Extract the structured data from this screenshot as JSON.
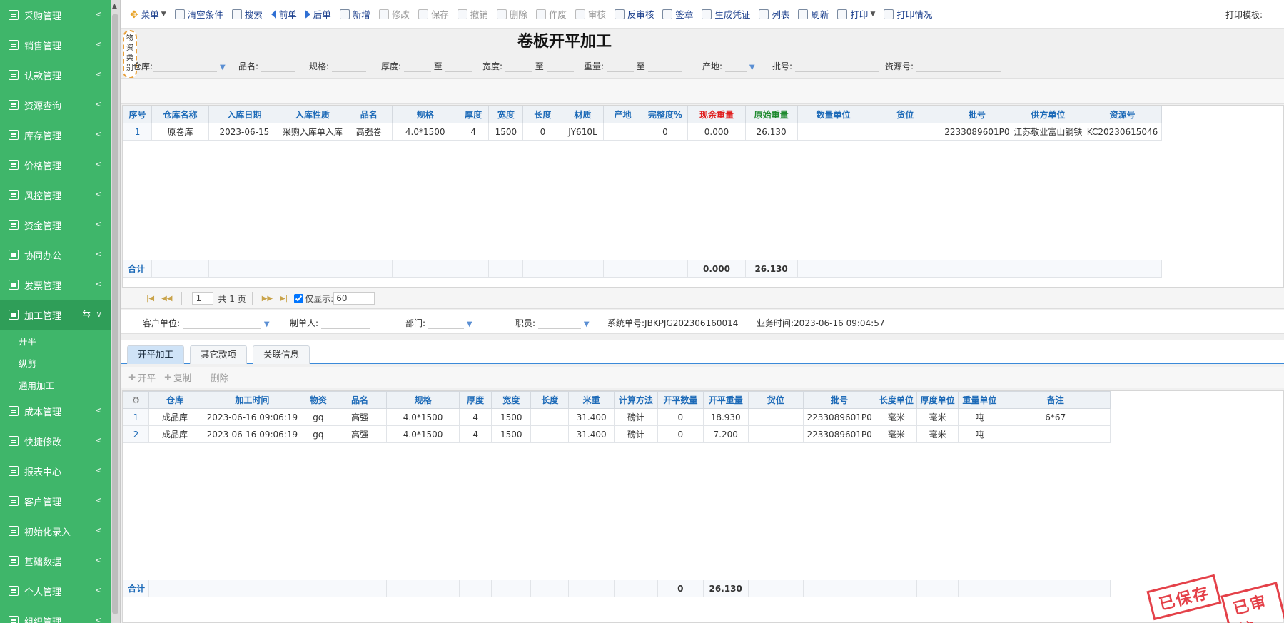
{
  "sidebar": {
    "items": [
      {
        "label": "采购管理",
        "active": false
      },
      {
        "label": "销售管理",
        "active": false
      },
      {
        "label": "认款管理",
        "active": false
      },
      {
        "label": "资源查询",
        "active": false
      },
      {
        "label": "库存管理",
        "active": false
      },
      {
        "label": "价格管理",
        "active": false
      },
      {
        "label": "风控管理",
        "active": false
      },
      {
        "label": "资金管理",
        "active": false
      },
      {
        "label": "协同办公",
        "active": false
      },
      {
        "label": "发票管理",
        "active": false
      },
      {
        "label": "加工管理",
        "active": true
      }
    ],
    "sub_items": [
      "开平",
      "纵剪",
      "通用加工"
    ],
    "items_after": [
      "成本管理",
      "快捷修改",
      "报表中心",
      "客户管理",
      "初始化录入",
      "基础数据",
      "个人管理",
      "组织管理"
    ]
  },
  "toolbar": {
    "buttons": [
      {
        "label": "菜单",
        "enabled": true,
        "icon": "menu-star-icon"
      },
      {
        "label": "清空条件",
        "enabled": true,
        "icon": "clear-icon"
      },
      {
        "label": "搜索",
        "enabled": true,
        "icon": "search-icon"
      },
      {
        "label": "前单",
        "enabled": true,
        "icon": "prev-icon"
      },
      {
        "label": "后单",
        "enabled": true,
        "icon": "next-icon"
      },
      {
        "label": "新增",
        "enabled": true,
        "icon": "add-icon"
      },
      {
        "label": "修改",
        "enabled": false,
        "icon": "edit-icon"
      },
      {
        "label": "保存",
        "enabled": false,
        "icon": "save-icon"
      },
      {
        "label": "撤销",
        "enabled": false,
        "icon": "undo-icon"
      },
      {
        "label": "删除",
        "enabled": false,
        "icon": "delete-icon"
      },
      {
        "label": "作废",
        "enabled": false,
        "icon": "void-icon"
      },
      {
        "label": "审核",
        "enabled": false,
        "icon": "audit-icon"
      },
      {
        "label": "反审核",
        "enabled": true,
        "icon": "unaudit-icon"
      },
      {
        "label": "签章",
        "enabled": true,
        "icon": "seal-icon"
      },
      {
        "label": "生成凭证",
        "enabled": true,
        "icon": "voucher-icon"
      },
      {
        "label": "列表",
        "enabled": true,
        "icon": "list-icon"
      },
      {
        "label": "刷新",
        "enabled": true,
        "icon": "refresh-icon"
      },
      {
        "label": "打印",
        "enabled": true,
        "icon": "print-icon"
      },
      {
        "label": "打印情况",
        "enabled": true,
        "icon": "print-status-icon"
      }
    ],
    "print_template_label": "打印模板:"
  },
  "form": {
    "title": "卷板开平加工",
    "category_badge": "物资类别",
    "filters": {
      "warehouse": "仓库:",
      "name": "品名:",
      "spec": "规格:",
      "thickness": "厚度:",
      "to": "至",
      "width": "宽度:",
      "weight": "重量:",
      "origin": "产地:",
      "batch": "批号:",
      "resource": "资源号:"
    }
  },
  "grid1": {
    "headers": [
      "序号",
      "仓库名称",
      "入库日期",
      "入库性质",
      "品名",
      "规格",
      "厚度",
      "宽度",
      "长度",
      "材质",
      "产地",
      "完整度%",
      "现余重量",
      "原始重量",
      "数量单位",
      "货位",
      "批号",
      "供方单位",
      "资源号"
    ],
    "rows": [
      [
        "1",
        "原卷库",
        "2023-06-15",
        "采购入库单入库",
        "高强卷",
        "4.0*1500",
        "4",
        "1500",
        "0",
        "JY610L",
        "",
        "0",
        "0.000",
        "26.130",
        "",
        "",
        "2233089601P0",
        "江苏敬业富山钢铁",
        "KC20230615046"
      ]
    ],
    "sum_label": "合计",
    "sum_remaining": "0.000",
    "sum_original": "26.130"
  },
  "pager": {
    "page": "1",
    "total_pages": "共 1 页",
    "show_only_label": "仅显示:",
    "show_only_checked": true,
    "count": "60"
  },
  "info": {
    "customer": "客户单位:",
    "maker": "制单人:",
    "dept": "部门:",
    "staff": "职员:",
    "sys_no": "系统单号:JBKPJG202306160014",
    "biz_time": "业务时间:2023-06-16 09:04:57"
  },
  "tabs": [
    "开平加工",
    "其它款项",
    "关联信息"
  ],
  "subtoolbar": [
    "开平",
    "复制",
    "删除"
  ],
  "grid2": {
    "headers": [
      "",
      "仓库",
      "加工时间",
      "物资",
      "品名",
      "规格",
      "厚度",
      "宽度",
      "长度",
      "米重",
      "计算方法",
      "开平数量",
      "开平重量",
      "货位",
      "批号",
      "长度单位",
      "厚度单位",
      "重量单位",
      "备注"
    ],
    "rows": [
      [
        "1",
        "成品库",
        "2023-06-16 09:06:19",
        "gq",
        "高强",
        "4.0*1500",
        "4",
        "1500",
        "",
        "31.400",
        "磅计",
        "0",
        "18.930",
        "",
        "2233089601P0",
        "毫米",
        "毫米",
        "吨",
        "6*67"
      ],
      [
        "2",
        "成品库",
        "2023-06-16 09:06:19",
        "gq",
        "高强",
        "4.0*1500",
        "4",
        "1500",
        "",
        "31.400",
        "磅计",
        "0",
        "7.200",
        "",
        "2233089601P0",
        "毫米",
        "毫米",
        "吨",
        ""
      ]
    ],
    "sum_label": "合计",
    "sum_qty": "0",
    "sum_weight": "26.130"
  },
  "stamps": [
    "已保存",
    "已审核"
  ],
  "colors": {
    "sidebar": "#3fb66a",
    "header_text": "#1e6bb8",
    "stamp": "#e0202a"
  }
}
